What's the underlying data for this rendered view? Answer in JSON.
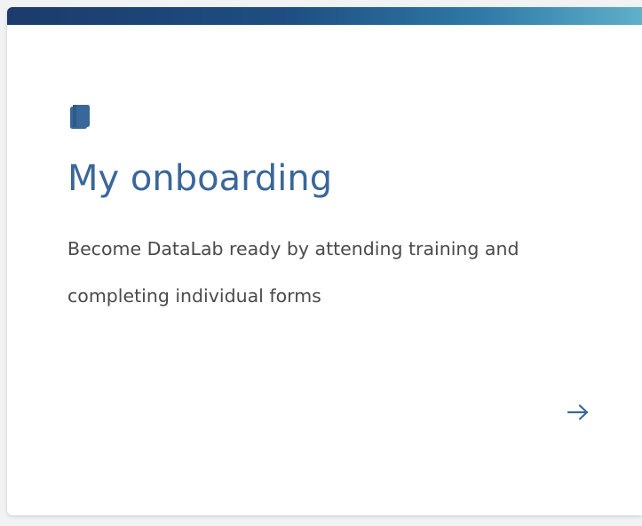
{
  "card": {
    "title": "My onboarding",
    "description": "Become DataLab ready by attending training and completing individual forms",
    "icon": "book-icon",
    "action_icon": "arrow-right-icon",
    "accent_color": "#3a6799",
    "topbar_gradient": [
      "#1b3b6b",
      "#1e4f82",
      "#2f7aa8",
      "#5fb0c9"
    ]
  }
}
